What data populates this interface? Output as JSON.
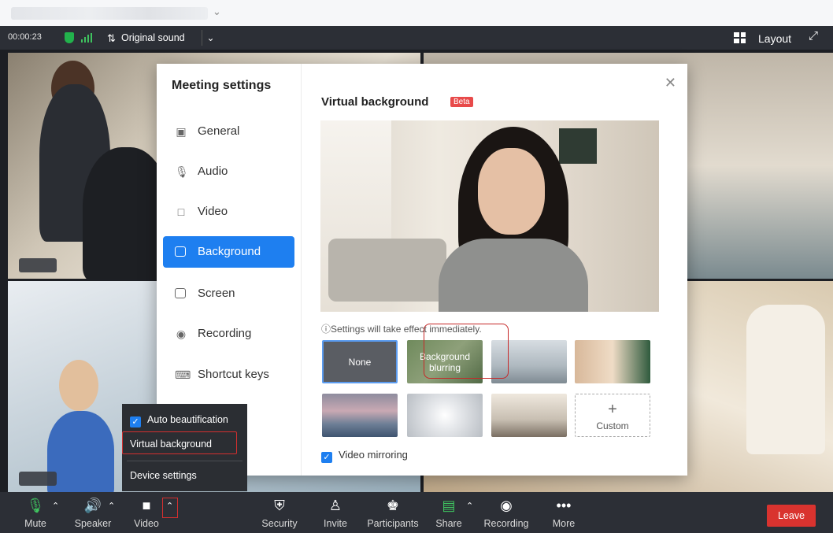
{
  "top_bar": {
    "timer": "00:00:23",
    "sound_label": "Original sound",
    "layout_label": "Layout"
  },
  "settings": {
    "title": "Meeting settings",
    "nav": [
      {
        "label": "General",
        "icon": "settings-icon"
      },
      {
        "label": "Audio",
        "icon": "microphone-icon"
      },
      {
        "label": "Video",
        "icon": "camera-icon"
      },
      {
        "label": "Background",
        "icon": "background-icon",
        "active": true
      },
      {
        "label": "Screen",
        "icon": "screen-icon"
      },
      {
        "label": "Recording",
        "icon": "record-icon"
      },
      {
        "label": "Shortcut keys",
        "icon": "keyboard-icon"
      }
    ],
    "vb_title": "Virtual background",
    "beta": "Beta",
    "note": "Settings will take effect immediately.",
    "thumbnails": {
      "none_label": "None",
      "blur_label": "Background\nblurring",
      "custom_label": "Custom",
      "custom_plus": "+"
    },
    "mirror_label": "Video mirroring",
    "mirror_checked": true
  },
  "video_menu": {
    "auto_beautification": "Auto beautification",
    "virtual_background": "Virtual background",
    "device_settings": "Device settings"
  },
  "toolbar": {
    "mute": "Mute",
    "speaker": "Speaker",
    "video": "Video",
    "security": "Security",
    "invite": "Invite",
    "participants": "Participants",
    "share": "Share",
    "recording": "Recording",
    "more": "More",
    "leave": "Leave"
  },
  "colors": {
    "accent": "#1e7ff0",
    "leave": "#d9332f",
    "highlight": "#c62828",
    "bar": "#2c2f36"
  }
}
